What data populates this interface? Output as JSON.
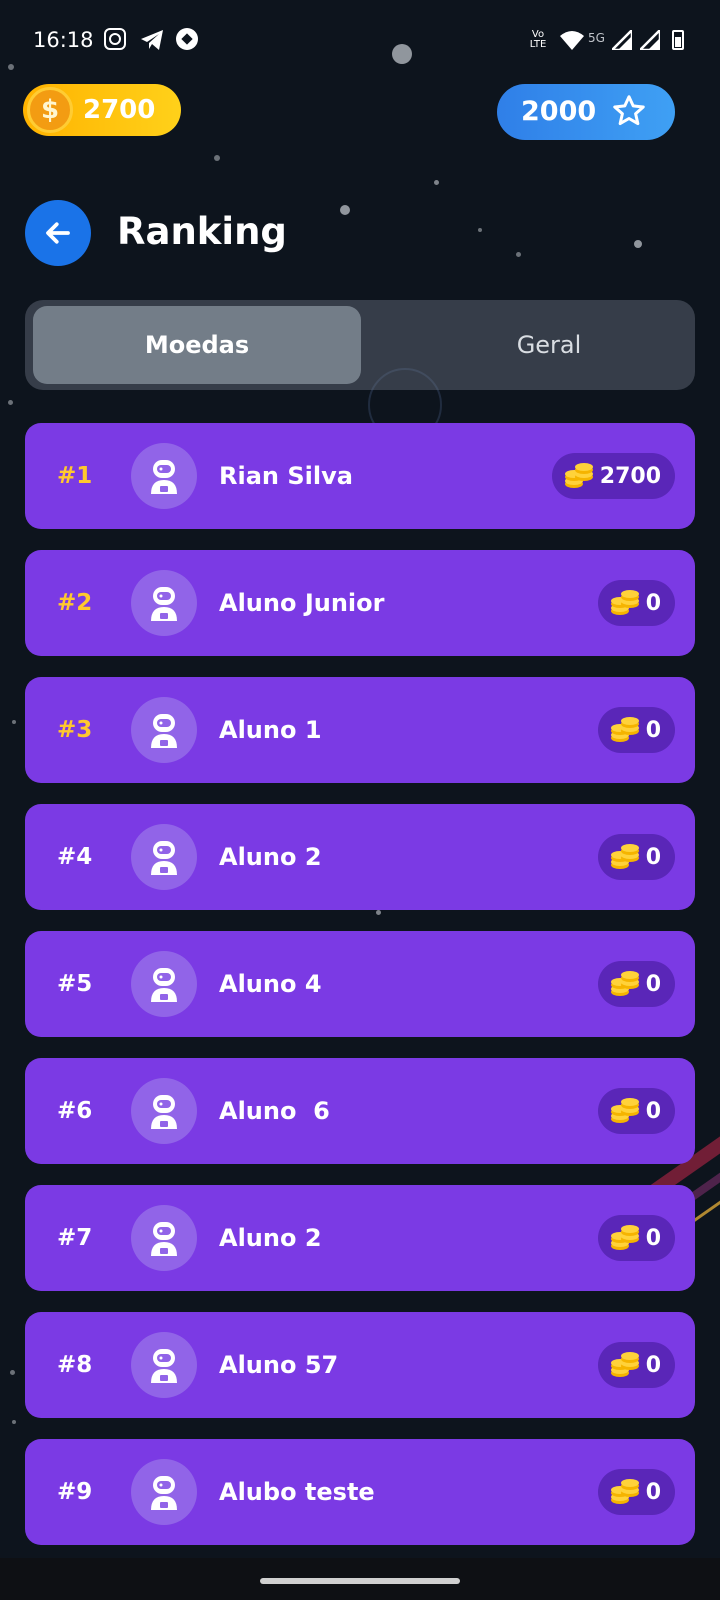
{
  "status_bar": {
    "time": "16:18",
    "network_label": "5G",
    "volte_label": "Vo LTE"
  },
  "wallet": {
    "coins": "2700",
    "stars": "2000",
    "coin_symbol": "$"
  },
  "header": {
    "title": "Ranking"
  },
  "tabs": [
    {
      "label": "Moedas",
      "active": true
    },
    {
      "label": "Geral",
      "active": false
    }
  ],
  "ranking": [
    {
      "rank": "#1",
      "name": "Rian Silva",
      "score": "2700",
      "highlight": true
    },
    {
      "rank": "#2",
      "name": "Aluno Junior",
      "score": "0",
      "highlight": true
    },
    {
      "rank": "#3",
      "name": "Aluno 1",
      "score": "0",
      "highlight": true
    },
    {
      "rank": "#4",
      "name": "Aluno 2",
      "score": "0",
      "highlight": false
    },
    {
      "rank": "#5",
      "name": "Aluno 4",
      "score": "0",
      "highlight": false
    },
    {
      "rank": "#6",
      "name": "Aluno  6",
      "score": "0",
      "highlight": false
    },
    {
      "rank": "#7",
      "name": "Aluno 2",
      "score": "0",
      "highlight": false
    },
    {
      "rank": "#8",
      "name": "Aluno 57",
      "score": "0",
      "highlight": false
    },
    {
      "rank": "#9",
      "name": "Alubo teste",
      "score": "0",
      "highlight": false
    }
  ],
  "colors": {
    "background": "#0d141d",
    "row": "#7b3ae4",
    "score_pill": "#5a26b8",
    "gold_rank": "#ffc82e",
    "back_button": "#1a73e8"
  },
  "icons": {
    "status": [
      "instagram-icon",
      "telegram-icon",
      "soccer-ball-icon",
      "volte-icon",
      "wifi-icon",
      "signal-icon",
      "battery-icon"
    ],
    "wallet_coin": "dollar-coin-icon",
    "wallet_star": "star-outline-icon",
    "back": "arrow-left-icon",
    "avatar": "astronaut-icon",
    "score": "coin-stack-icon"
  }
}
